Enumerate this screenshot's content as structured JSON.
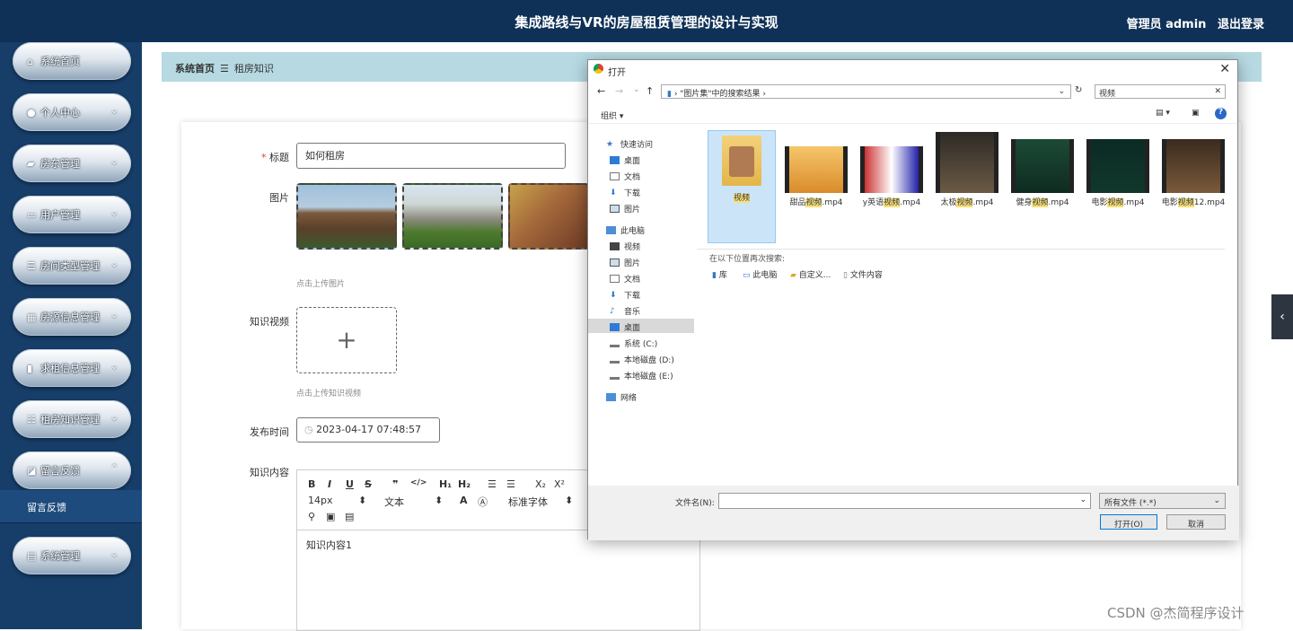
{
  "header": {
    "title": "集成路线与VR的房屋租赁管理的设计与实现",
    "user_label": "管理员 admin",
    "logout": "退出登录"
  },
  "sidebar": {
    "items": [
      {
        "label": "系统首页",
        "icon": "home-icon"
      },
      {
        "label": "个人中心",
        "icon": "user-icon"
      },
      {
        "label": "房东管理",
        "icon": "car-icon"
      },
      {
        "label": "用户管理",
        "icon": "monitor-icon"
      },
      {
        "label": "房间类型管理",
        "icon": "list-icon"
      },
      {
        "label": "房源信息管理",
        "icon": "grid-icon"
      },
      {
        "label": "求租信息管理",
        "icon": "book-icon"
      },
      {
        "label": "租房知识管理",
        "icon": "sliders-icon"
      },
      {
        "label": "留言反馈",
        "icon": "chart-icon"
      },
      {
        "label": "系统管理",
        "icon": "clipboard-icon"
      }
    ],
    "sub_item": "留言反馈"
  },
  "breadcrumb": {
    "home": "系统首页",
    "sep": "☰",
    "current": "租房知识"
  },
  "form": {
    "title_label": "标题",
    "title_required": "*",
    "title_value": "如何租房",
    "image_label": "图片",
    "image_tip": "点击上传图片",
    "video_label": "知识视频",
    "video_tip": "点击上传知识视频",
    "time_label": "发布时间",
    "time_value": "2023-04-17 07:48:57",
    "content_label": "知识内容",
    "content_value": "知识内容1",
    "toolbar": {
      "bold": "B",
      "italic": "I",
      "underline": "U",
      "strike": "S",
      "quote": "❞",
      "code": "</>",
      "h1": "H₁",
      "h2": "H₂",
      "ol": "☰",
      "ul": "☰",
      "sub": "X₂",
      "sup": "X²",
      "size": "14px",
      "type": "文本",
      "font": "标准字体"
    }
  },
  "dialog": {
    "title": "打开",
    "address": "\"图片集\"中的搜索结果",
    "search": "视频",
    "organize": "组织 ▾",
    "nav": {
      "quick": "快速访问",
      "desktop": "桌面",
      "docs": "文档",
      "downloads": "下载",
      "pictures": "图片",
      "pc": "此电脑",
      "videos": "视频",
      "music": "音乐",
      "sysc": "系统 (C:)",
      "diskd": "本地磁盘 (D:)",
      "diske": "本地磁盘 (E:)",
      "network": "网络"
    },
    "files": [
      {
        "pre": "",
        "hl": "视频",
        "post": ""
      },
      {
        "pre": "甜品",
        "hl": "视频",
        "post": ".mp4"
      },
      {
        "pre": "y英语",
        "hl": "视频",
        "post": ".mp4"
      },
      {
        "pre": "太极",
        "hl": "视频",
        "post": ".mp4"
      },
      {
        "pre": "健身",
        "hl": "视频",
        "post": ".mp4"
      },
      {
        "pre": "电影",
        "hl": "视频",
        "post": ".mp4"
      },
      {
        "pre": "电影",
        "hl": "视频",
        "post": "12.mp4"
      }
    ],
    "search_again": "在以下位置再次搜索:",
    "locs": {
      "lib": "库",
      "pc": "此电脑",
      "custom": "自定义...",
      "content": "文件内容"
    },
    "filename_label": "文件名(N):",
    "filetype": "所有文件 (*.*)",
    "open": "打开(O)",
    "cancel": "取消"
  },
  "watermark": "CSDN @杰简程序设计"
}
